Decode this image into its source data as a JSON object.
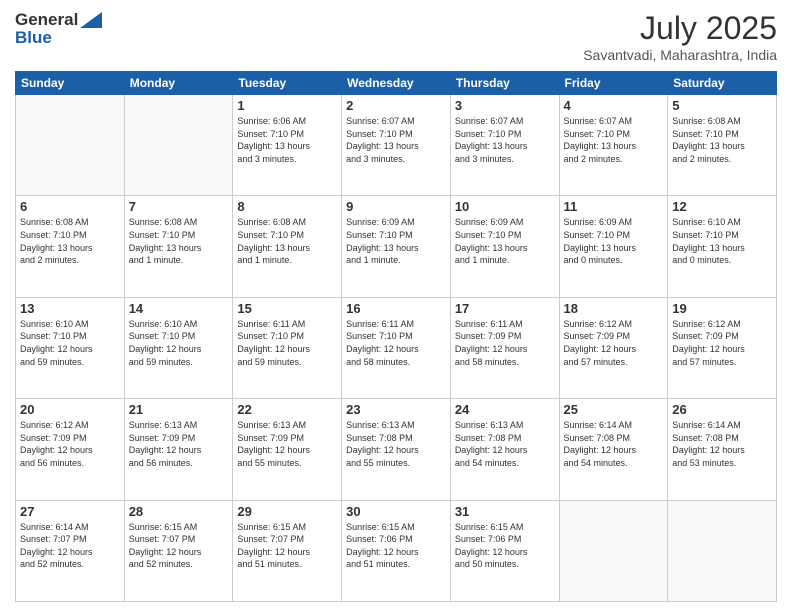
{
  "header": {
    "logo_line1": "General",
    "logo_line2": "Blue",
    "title": "July 2025",
    "location": "Savantvadi, Maharashtra, India"
  },
  "weekdays": [
    "Sunday",
    "Monday",
    "Tuesday",
    "Wednesday",
    "Thursday",
    "Friday",
    "Saturday"
  ],
  "weeks": [
    [
      {
        "day": "",
        "info": ""
      },
      {
        "day": "",
        "info": ""
      },
      {
        "day": "1",
        "info": "Sunrise: 6:06 AM\nSunset: 7:10 PM\nDaylight: 13 hours\nand 3 minutes."
      },
      {
        "day": "2",
        "info": "Sunrise: 6:07 AM\nSunset: 7:10 PM\nDaylight: 13 hours\nand 3 minutes."
      },
      {
        "day": "3",
        "info": "Sunrise: 6:07 AM\nSunset: 7:10 PM\nDaylight: 13 hours\nand 3 minutes."
      },
      {
        "day": "4",
        "info": "Sunrise: 6:07 AM\nSunset: 7:10 PM\nDaylight: 13 hours\nand 2 minutes."
      },
      {
        "day": "5",
        "info": "Sunrise: 6:08 AM\nSunset: 7:10 PM\nDaylight: 13 hours\nand 2 minutes."
      }
    ],
    [
      {
        "day": "6",
        "info": "Sunrise: 6:08 AM\nSunset: 7:10 PM\nDaylight: 13 hours\nand 2 minutes."
      },
      {
        "day": "7",
        "info": "Sunrise: 6:08 AM\nSunset: 7:10 PM\nDaylight: 13 hours\nand 1 minute."
      },
      {
        "day": "8",
        "info": "Sunrise: 6:08 AM\nSunset: 7:10 PM\nDaylight: 13 hours\nand 1 minute."
      },
      {
        "day": "9",
        "info": "Sunrise: 6:09 AM\nSunset: 7:10 PM\nDaylight: 13 hours\nand 1 minute."
      },
      {
        "day": "10",
        "info": "Sunrise: 6:09 AM\nSunset: 7:10 PM\nDaylight: 13 hours\nand 1 minute."
      },
      {
        "day": "11",
        "info": "Sunrise: 6:09 AM\nSunset: 7:10 PM\nDaylight: 13 hours\nand 0 minutes."
      },
      {
        "day": "12",
        "info": "Sunrise: 6:10 AM\nSunset: 7:10 PM\nDaylight: 13 hours\nand 0 minutes."
      }
    ],
    [
      {
        "day": "13",
        "info": "Sunrise: 6:10 AM\nSunset: 7:10 PM\nDaylight: 12 hours\nand 59 minutes."
      },
      {
        "day": "14",
        "info": "Sunrise: 6:10 AM\nSunset: 7:10 PM\nDaylight: 12 hours\nand 59 minutes."
      },
      {
        "day": "15",
        "info": "Sunrise: 6:11 AM\nSunset: 7:10 PM\nDaylight: 12 hours\nand 59 minutes."
      },
      {
        "day": "16",
        "info": "Sunrise: 6:11 AM\nSunset: 7:10 PM\nDaylight: 12 hours\nand 58 minutes."
      },
      {
        "day": "17",
        "info": "Sunrise: 6:11 AM\nSunset: 7:09 PM\nDaylight: 12 hours\nand 58 minutes."
      },
      {
        "day": "18",
        "info": "Sunrise: 6:12 AM\nSunset: 7:09 PM\nDaylight: 12 hours\nand 57 minutes."
      },
      {
        "day": "19",
        "info": "Sunrise: 6:12 AM\nSunset: 7:09 PM\nDaylight: 12 hours\nand 57 minutes."
      }
    ],
    [
      {
        "day": "20",
        "info": "Sunrise: 6:12 AM\nSunset: 7:09 PM\nDaylight: 12 hours\nand 56 minutes."
      },
      {
        "day": "21",
        "info": "Sunrise: 6:13 AM\nSunset: 7:09 PM\nDaylight: 12 hours\nand 56 minutes."
      },
      {
        "day": "22",
        "info": "Sunrise: 6:13 AM\nSunset: 7:09 PM\nDaylight: 12 hours\nand 55 minutes."
      },
      {
        "day": "23",
        "info": "Sunrise: 6:13 AM\nSunset: 7:08 PM\nDaylight: 12 hours\nand 55 minutes."
      },
      {
        "day": "24",
        "info": "Sunrise: 6:13 AM\nSunset: 7:08 PM\nDaylight: 12 hours\nand 54 minutes."
      },
      {
        "day": "25",
        "info": "Sunrise: 6:14 AM\nSunset: 7:08 PM\nDaylight: 12 hours\nand 54 minutes."
      },
      {
        "day": "26",
        "info": "Sunrise: 6:14 AM\nSunset: 7:08 PM\nDaylight: 12 hours\nand 53 minutes."
      }
    ],
    [
      {
        "day": "27",
        "info": "Sunrise: 6:14 AM\nSunset: 7:07 PM\nDaylight: 12 hours\nand 52 minutes."
      },
      {
        "day": "28",
        "info": "Sunrise: 6:15 AM\nSunset: 7:07 PM\nDaylight: 12 hours\nand 52 minutes."
      },
      {
        "day": "29",
        "info": "Sunrise: 6:15 AM\nSunset: 7:07 PM\nDaylight: 12 hours\nand 51 minutes."
      },
      {
        "day": "30",
        "info": "Sunrise: 6:15 AM\nSunset: 7:06 PM\nDaylight: 12 hours\nand 51 minutes."
      },
      {
        "day": "31",
        "info": "Sunrise: 6:15 AM\nSunset: 7:06 PM\nDaylight: 12 hours\nand 50 minutes."
      },
      {
        "day": "",
        "info": ""
      },
      {
        "day": "",
        "info": ""
      }
    ]
  ]
}
